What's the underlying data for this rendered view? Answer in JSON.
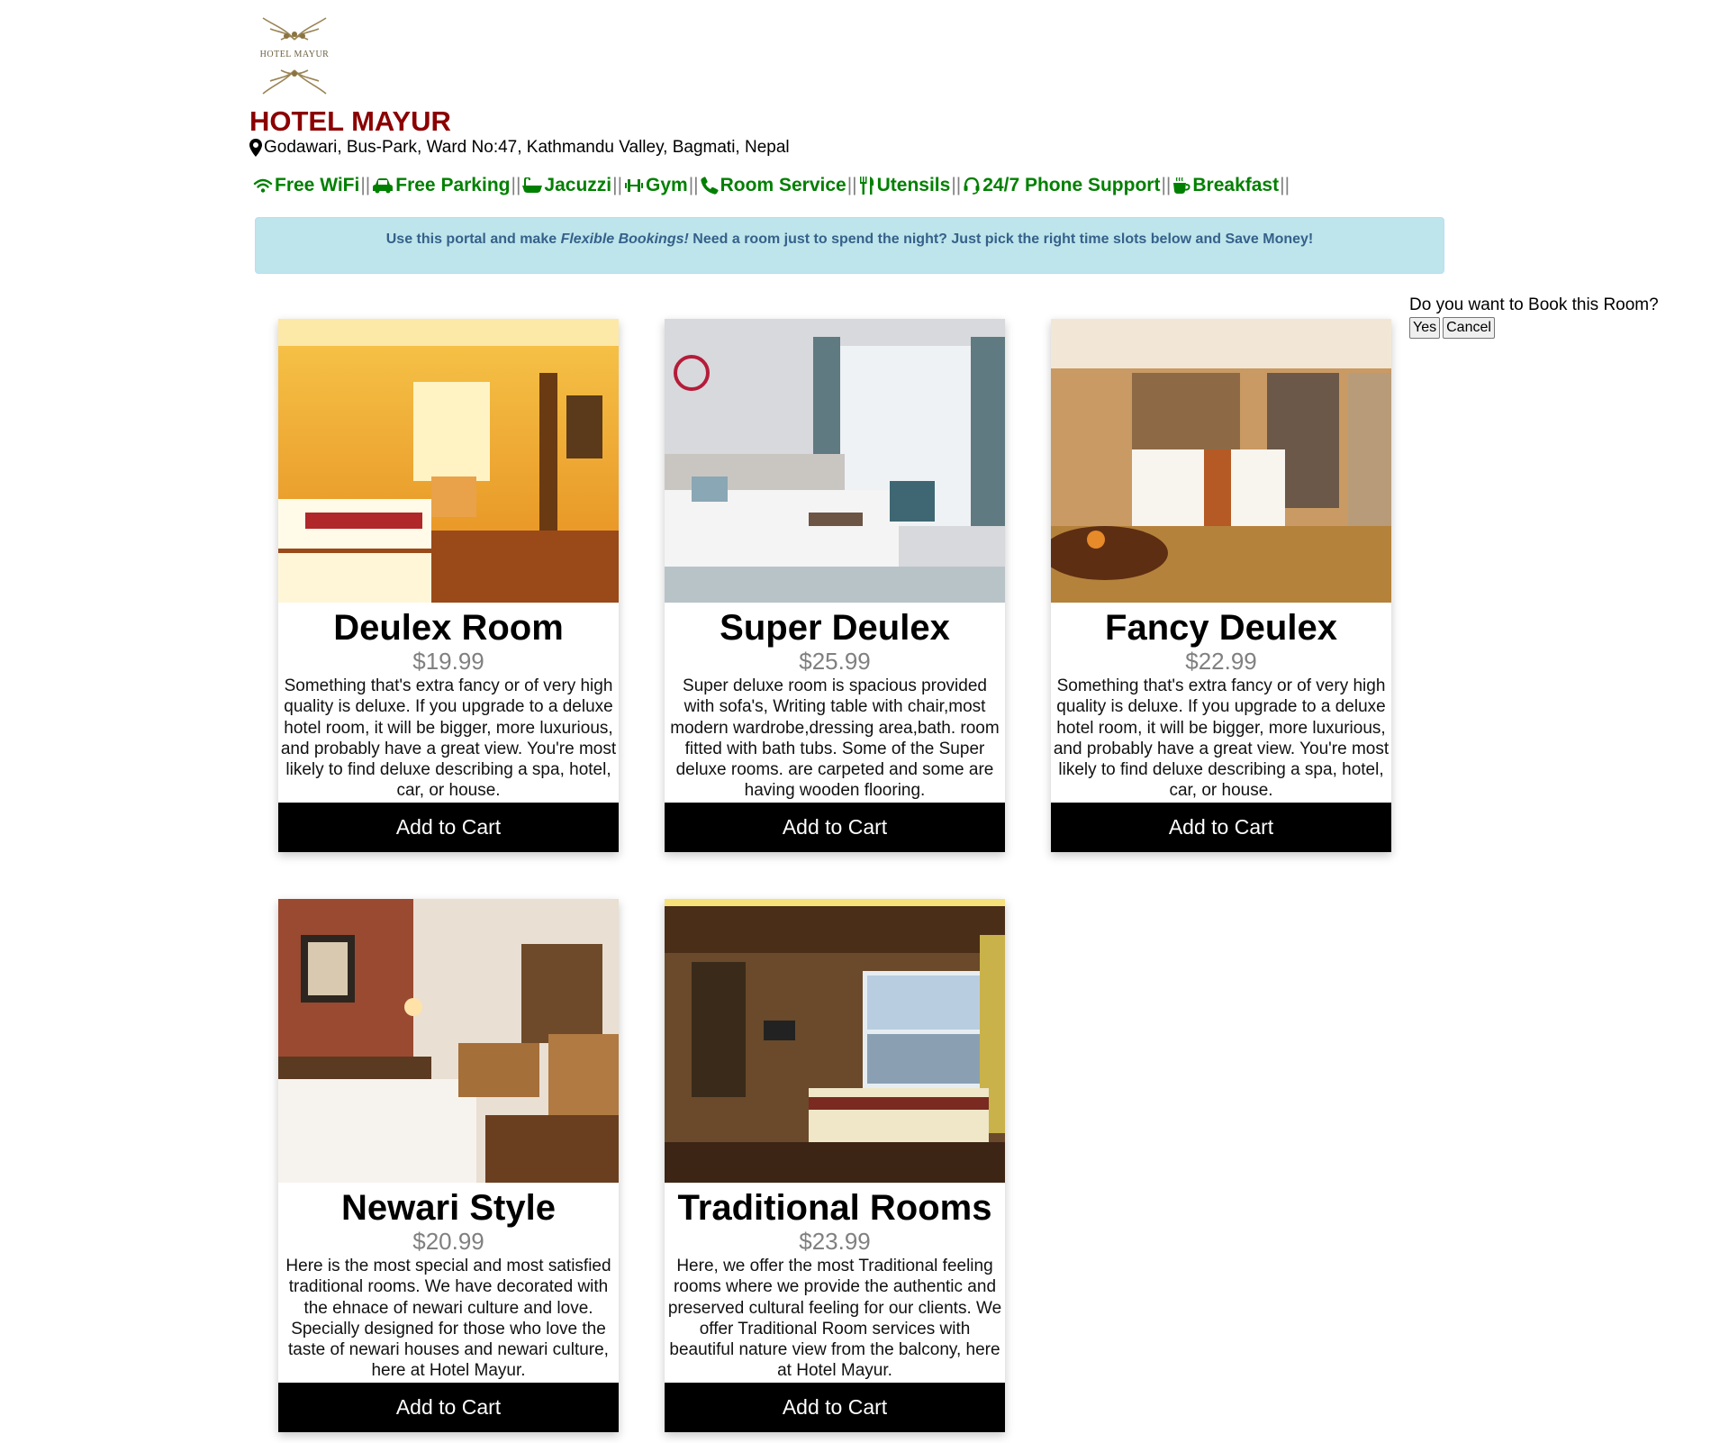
{
  "brand": {
    "logo_text": "HOTEL MAYUR",
    "name": "HOTEL MAYUR",
    "name_color": "#8b0000",
    "address": "Godawari, Bus-Park, Ward No:47, Kathmandu Valley, Bagmati, Nepal",
    "address_icon": "map-marker-icon"
  },
  "amenities": [
    {
      "label": "Free WiFi",
      "icon": "wifi-icon"
    },
    {
      "label": "Free Parking",
      "icon": "car-icon"
    },
    {
      "label": "Jacuzzi",
      "icon": "bathtub-icon"
    },
    {
      "label": "Gym",
      "icon": "dumbbell-icon"
    },
    {
      "label": "Room Service",
      "icon": "phone-icon"
    },
    {
      "label": "Utensils",
      "icon": "utensils-icon"
    },
    {
      "label": "24/7 Phone Support",
      "icon": "headset-icon"
    },
    {
      "label": "Breakfast",
      "icon": "coffee-icon"
    }
  ],
  "amenity_separator": "||",
  "amenity_color": "#008000",
  "banner": {
    "before": "Use this portal and make ",
    "emphasis": "Flexible Bookings!",
    "after": " Need a room just to spend the night? Just pick the right time slots below and Save Money!"
  },
  "confirm": {
    "question": "Do you want to Book this Room?",
    "yes": "Yes",
    "cancel": "Cancel"
  },
  "rooms": [
    {
      "title": "Deulex Room",
      "price": "$19.99",
      "description": "Something that's extra fancy or of very high quality is deluxe. If you upgrade to a deluxe hotel room, it will be bigger, more luxurious, and probably have a great view. You're most likely to find deluxe describing a spa, hotel, car, or house.",
      "button": "Add to Cart"
    },
    {
      "title": "Super Deulex",
      "price": "$25.99",
      "description": "Super deluxe room is spacious provided with sofa's, Writing table with chair,most modern wardrobe,dressing area,bath. room fitted with bath tubs. Some of the Super deluxe rooms. are carpeted and some are having wooden flooring.",
      "button": "Add to Cart"
    },
    {
      "title": "Fancy Deulex",
      "price": "$22.99",
      "description": "Something that's extra fancy or of very high quality is deluxe. If you upgrade to a deluxe hotel room, it will be bigger, more luxurious, and probably have a great view. You're most likely to find deluxe describing a spa, hotel, car, or house.",
      "button": "Add to Cart"
    },
    {
      "title": "Newari Style",
      "price": "$20.99",
      "description": "Here is the most special and most satisfied traditional rooms. We have decorated with the ehnace of newari culture and love. Specially designed for those who love the taste of newari houses and newari culture, here at Hotel Mayur.",
      "button": "Add to Cart"
    },
    {
      "title": "Traditional Rooms",
      "price": "$23.99",
      "description": "Here, we offer the most Traditional feeling rooms where we provide the authentic and preserved cultural feeling for our clients. We offer Traditional Room services with beautiful nature view from the balcony, here at Hotel Mayur.",
      "button": "Add to Cart"
    }
  ]
}
